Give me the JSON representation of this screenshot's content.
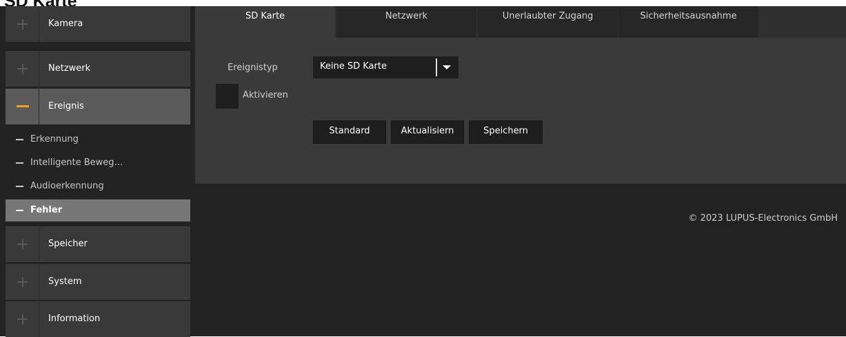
{
  "page": {
    "heading": "SD Karte"
  },
  "sidebar": {
    "items": [
      {
        "label": "Kamera"
      },
      {
        "label": "Netzwerk"
      },
      {
        "label": "Ereignis"
      },
      {
        "label": "Speicher"
      },
      {
        "label": "System"
      },
      {
        "label": "Information"
      }
    ],
    "subitems": [
      {
        "label": "Erkennung"
      },
      {
        "label": "Intelligente Beweg…"
      },
      {
        "label": "Audioerkennung"
      },
      {
        "label": "Fehler"
      }
    ]
  },
  "tabs": [
    {
      "label": "SD Karte"
    },
    {
      "label": "Netzwerk"
    },
    {
      "label": "Unerlaubter Zugang"
    },
    {
      "label": "Sicherheitsausnahme"
    }
  ],
  "form": {
    "event_type_label": "Ereignistyp",
    "event_type_value": "Keine SD Karte",
    "activate_label": "Aktivieren",
    "activate_checked": false
  },
  "buttons": {
    "standard": "Standard",
    "refresh": "Aktualisiern",
    "save": "Speichern"
  },
  "footer": {
    "copyright": "© 2023 LUPUS-Electronics GmbH"
  },
  "colors": {
    "accent": "#f0a020",
    "background": "#222222",
    "panel": "#3a3a3a"
  }
}
